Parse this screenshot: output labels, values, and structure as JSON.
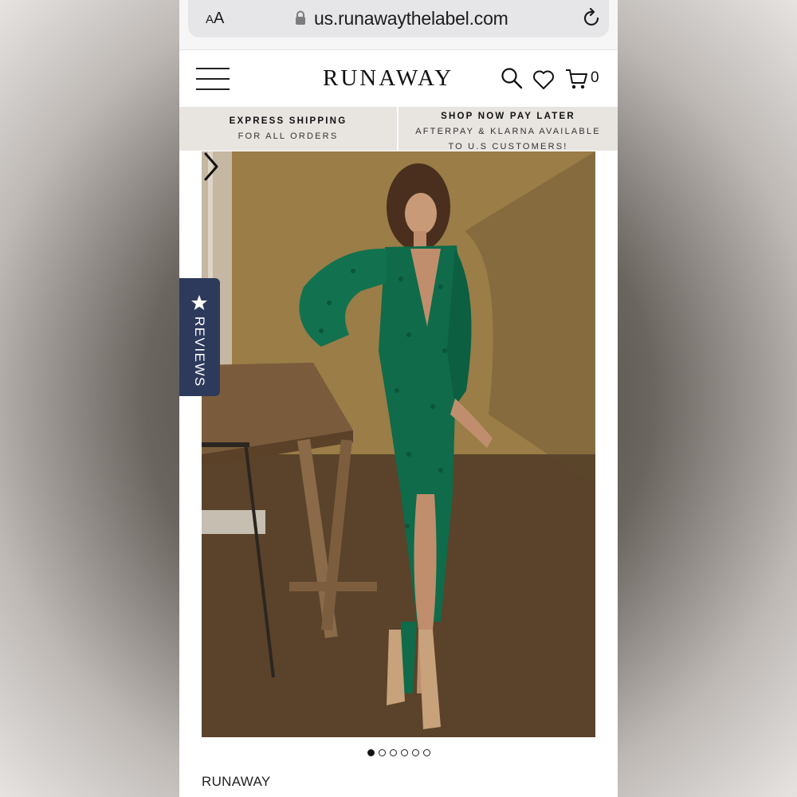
{
  "browser": {
    "text_size_button": "AA",
    "url": "us.runawaythelabel.com"
  },
  "header": {
    "brand": "RUNAWAY",
    "cart_count": "0",
    "icons": [
      "menu-icon",
      "search-icon",
      "heart-icon",
      "cart-icon"
    ]
  },
  "promo": {
    "left_title": "EXPRESS SHIPPING",
    "left_sub": "FOR ALL ORDERS",
    "right_title": "SHOP NOW PAY LATER",
    "right_sub_line1": "AFTERPAY & KLARNA AVAILABLE",
    "right_sub_line2": "TO U.S CUSTOMERS!"
  },
  "reviews_tab": {
    "label": "REVIEWS"
  },
  "carousel": {
    "total_slides": 6,
    "active_slide": 1
  },
  "product": {
    "brand": "RUNAWAY"
  },
  "colors": {
    "reviews_tab": "#2e3a5c",
    "promo_band": "#e8e4e0",
    "dress_green": "#0f6b4a"
  }
}
